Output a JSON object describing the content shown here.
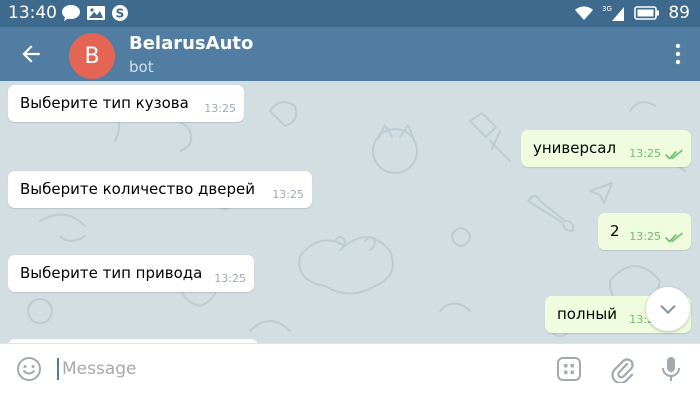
{
  "status_bar": {
    "time": "13:40",
    "network_label": "3G",
    "battery": "89",
    "icons": [
      "chat-bubble-icon",
      "image-icon",
      "skype-icon",
      "wifi-icon",
      "signal-icon",
      "battery-icon"
    ]
  },
  "header": {
    "avatar_letter": "B",
    "title": "BelarusAuto",
    "subtitle": "bot",
    "colors": {
      "bar": "#527da3",
      "avatar": "#e56555"
    }
  },
  "messages": [
    {
      "direction": "incoming",
      "text": "Выберите тип кузова",
      "time": "13:25"
    },
    {
      "direction": "outgoing",
      "text": "универсал",
      "time": "13:25",
      "read": true
    },
    {
      "direction": "incoming",
      "text": "Выберите количество дверей",
      "time": "13:25"
    },
    {
      "direction": "outgoing",
      "text": "2",
      "time": "13:25",
      "read": true
    },
    {
      "direction": "incoming",
      "text": "Выберите тип привода",
      "time": "13:25"
    },
    {
      "direction": "outgoing",
      "text": "полный",
      "time": "13:25",
      "read": true
    }
  ],
  "composer": {
    "placeholder": "Message"
  }
}
